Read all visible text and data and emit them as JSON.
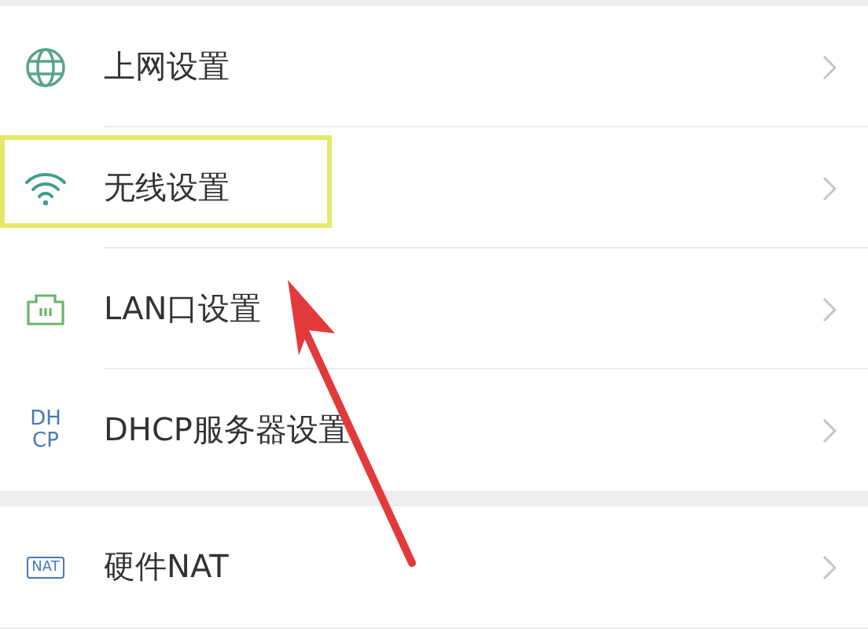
{
  "groups": [
    {
      "items": [
        {
          "kind": "globe",
          "label": "上网设置",
          "highlighted": false
        },
        {
          "kind": "wifi",
          "label": "无线设置",
          "highlighted": true
        },
        {
          "kind": "lan",
          "label": "LAN口设置",
          "highlighted": false
        },
        {
          "kind": "text",
          "icon_lines": [
            "DH",
            "CP"
          ],
          "label": "DHCP服务器设置",
          "highlighted": false
        }
      ]
    },
    {
      "items": [
        {
          "kind": "badge",
          "icon_lines": [
            "NAT"
          ],
          "label": "硬件NAT",
          "highlighted": false
        }
      ]
    }
  ]
}
